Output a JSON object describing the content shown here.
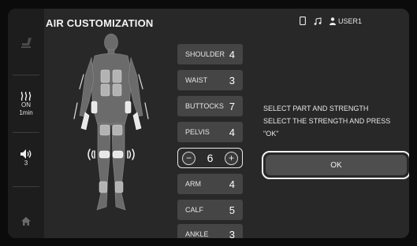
{
  "header": {
    "title": "AIR CUSTOMIZATION",
    "user": "USER1",
    "icons": [
      "phone-icon",
      "music-icon",
      "user-icon"
    ]
  },
  "sidebar": {
    "items": [
      {
        "icon": "recline-icon"
      },
      {
        "icon": "heat-icon",
        "state": "ON",
        "time": "1min"
      },
      {
        "icon": "volume-icon",
        "level": "3"
      },
      {
        "icon": "home-icon"
      }
    ]
  },
  "parts": [
    {
      "label": "SHOULDER",
      "value": "4"
    },
    {
      "label": "WAIST",
      "value": "3"
    },
    {
      "label": "BUTTOCKS",
      "value": "7"
    },
    {
      "label": "PELVIS",
      "value": "4"
    },
    {
      "label": "ARM",
      "value": "4"
    },
    {
      "label": "CALF",
      "value": "5"
    },
    {
      "label": "ANKLE",
      "value": "3"
    }
  ],
  "stepper": {
    "minus": "−",
    "value": "6",
    "plus": "+"
  },
  "message": {
    "line1": "SELECT PART AND STRENGTH",
    "line2": "SELECT THE STRENGTH AND PRESS",
    "line3": "\"OK\""
  },
  "ok_label": "OK"
}
